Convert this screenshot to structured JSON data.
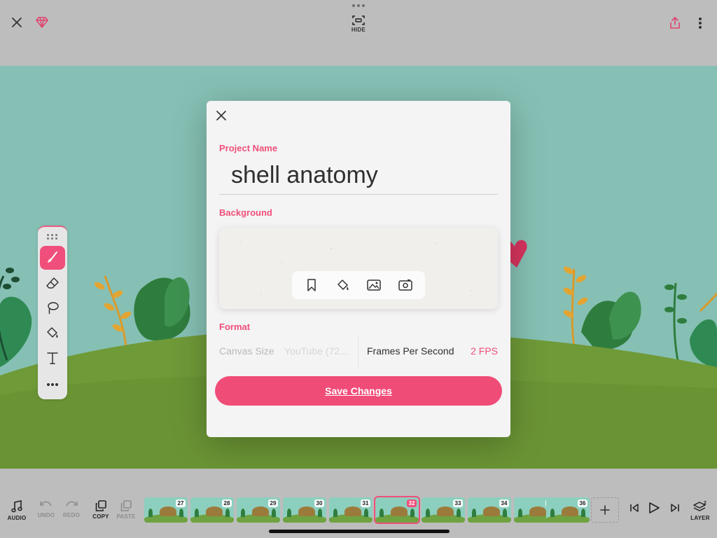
{
  "topbar": {
    "hide_label": "HIDE"
  },
  "palette": {
    "tools": [
      "brush-icon",
      "eraser-icon",
      "lasso-icon",
      "fill-bucket-icon",
      "text-tool-icon",
      "more-tools-icon"
    ],
    "active_tool": "brush-icon"
  },
  "dialog": {
    "project_name_label": "Project Name",
    "project_name_value": "shell anatomy",
    "background_label": "Background",
    "format_label": "Format",
    "canvas_size_label": "Canvas Size",
    "canvas_size_value": "YouTube (72...",
    "fps_label": "Frames Per Second",
    "fps_value": "2 FPS",
    "save_label": "Save Changes"
  },
  "bottombar": {
    "audio_label": "AUDIO",
    "undo_label": "UNDO",
    "redo_label": "REDO",
    "copy_label": "COPY",
    "paste_label": "PASTE",
    "layer_label": "LAYER",
    "layer_count": "2",
    "frames": [
      {
        "num": "27"
      },
      {
        "num": "28"
      },
      {
        "num": "29"
      },
      {
        "num": "30"
      },
      {
        "num": "31"
      },
      {
        "num": "32",
        "selected": true
      },
      {
        "num": "33"
      },
      {
        "num": "34"
      },
      {
        "num": "35"
      },
      {
        "num": "36"
      }
    ]
  },
  "colors": {
    "accent": "#ef4f7a",
    "scene_sky": "#86c0b4",
    "scene_grass": "#6f9a38",
    "chrome": "#bdbdbd"
  }
}
